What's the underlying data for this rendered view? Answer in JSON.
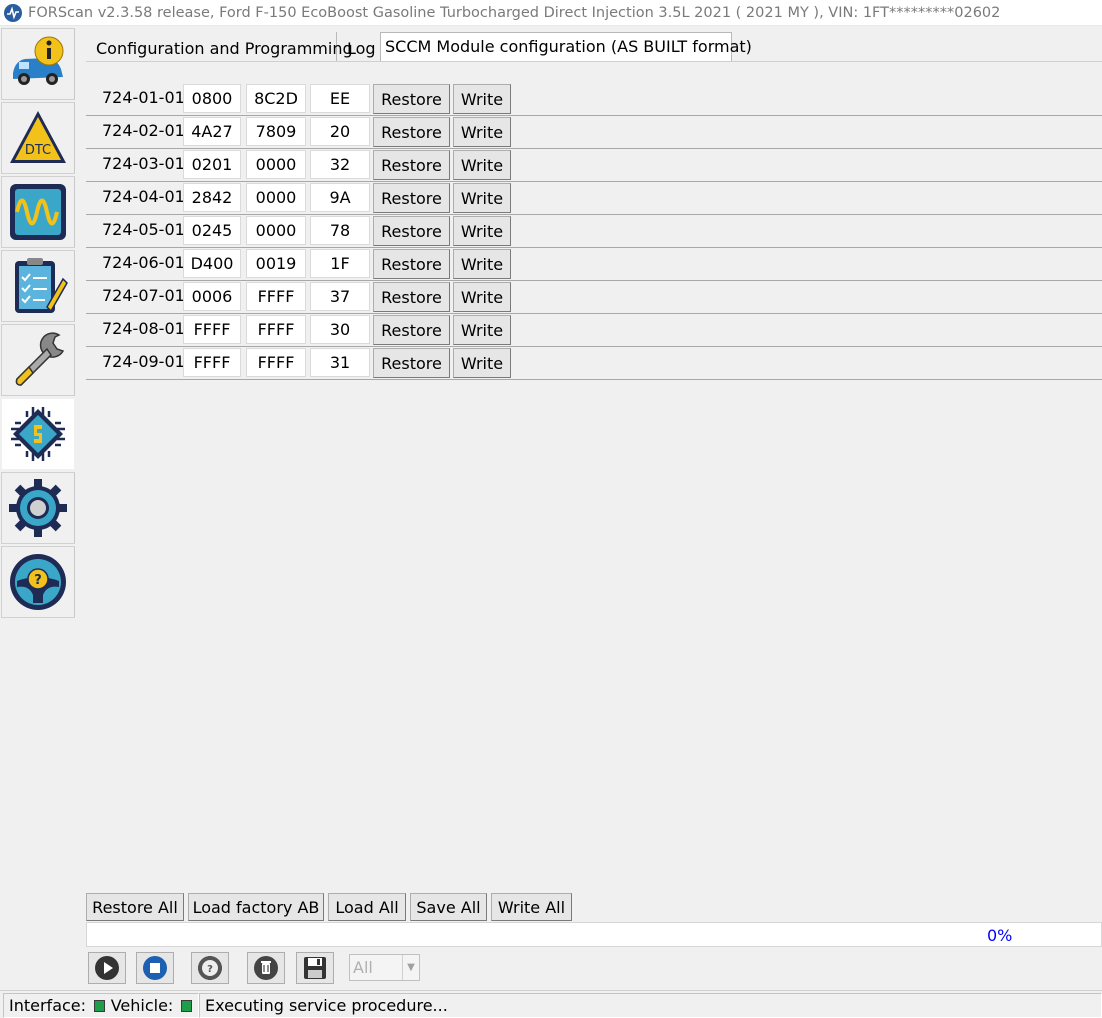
{
  "window": {
    "title": "FORScan v2.3.58 release, Ford F-150 EcoBoost Gasoline Turbocharged Direct Injection 3.5L 2021 ( 2021 MY ), VIN: 1FT*********02602"
  },
  "sidebar": {
    "items": [
      {
        "name": "vehicle-info",
        "icon": "car-info-icon",
        "active": false
      },
      {
        "name": "dtc",
        "icon": "dtc-warning-icon",
        "label": "DTC",
        "active": false
      },
      {
        "name": "oscilloscope",
        "icon": "oscilloscope-icon",
        "active": false
      },
      {
        "name": "tests",
        "icon": "checklist-icon",
        "active": false
      },
      {
        "name": "service",
        "icon": "wrench-icon",
        "active": false
      },
      {
        "name": "configuration",
        "icon": "chip-icon",
        "active": true
      },
      {
        "name": "settings",
        "icon": "gear-icon",
        "active": false
      },
      {
        "name": "help",
        "icon": "help-steering-icon",
        "active": false
      }
    ]
  },
  "tabs": [
    {
      "label": "Configuration and Programming",
      "active": false
    },
    {
      "label": "Log",
      "active": false
    },
    {
      "label": "SCCM Module configuration (AS BUILT format)",
      "active": true
    }
  ],
  "rows": [
    {
      "label": "724-01-01",
      "v1": "0800",
      "v2": "8C2D",
      "v3": "EE"
    },
    {
      "label": "724-02-01",
      "v1": "4A27",
      "v2": "7809",
      "v3": "20"
    },
    {
      "label": "724-03-01",
      "v1": "0201",
      "v2": "0000",
      "v3": "32"
    },
    {
      "label": "724-04-01",
      "v1": "2842",
      "v2": "0000",
      "v3": "9A"
    },
    {
      "label": "724-05-01",
      "v1": "0245",
      "v2": "0000",
      "v3": "78"
    },
    {
      "label": "724-06-01",
      "v1": "D400",
      "v2": "0019",
      "v3": "1F"
    },
    {
      "label": "724-07-01",
      "v1": "0006",
      "v2": "FFFF",
      "v3": "37"
    },
    {
      "label": "724-08-01",
      "v1": "FFFF",
      "v2": "FFFF",
      "v3": "30"
    },
    {
      "label": "724-09-01",
      "v1": "FFFF",
      "v2": "FFFF",
      "v3": "31"
    }
  ],
  "row_buttons": {
    "restore": "Restore",
    "write": "Write"
  },
  "bottom_buttons": {
    "restore_all": "Restore All",
    "load_factory": "Load factory AB",
    "load_all": "Load All",
    "save_all": "Save All",
    "write_all": "Write All"
  },
  "progress": {
    "text": "0%",
    "value": 0
  },
  "toolbar": {
    "buttons": [
      "play-icon",
      "stop-icon",
      "lifebuoy-help-icon",
      "erase-icon",
      "save-disk-icon"
    ],
    "filter_value": "All"
  },
  "status": {
    "interface_label": "Interface:",
    "vehicle_label": "Vehicle:",
    "message": "Executing service procedure...",
    "led_color": "#1e9e48"
  }
}
